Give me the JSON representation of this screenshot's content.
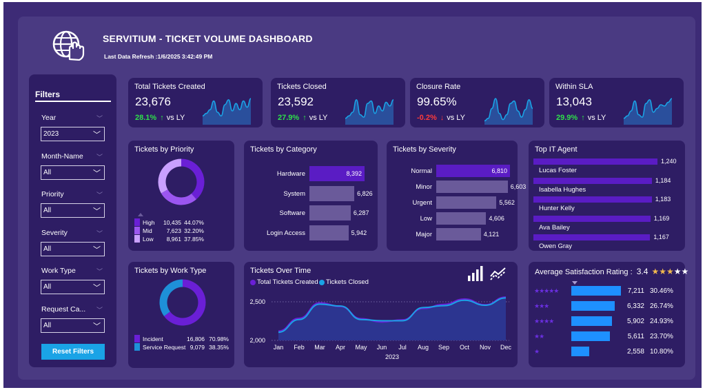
{
  "header": {
    "title": "SERVITIUM - TICKET VOLUME DASHBOARD",
    "refresh": "Last Data Refresh :1/6/2025 3:42:49 PM"
  },
  "filters": {
    "title": "Filters",
    "items": [
      {
        "label": "Year",
        "value": "2023"
      },
      {
        "label": "Month-Name",
        "value": "All"
      },
      {
        "label": "Priority",
        "value": "All"
      },
      {
        "label": "Severity",
        "value": "All"
      },
      {
        "label": "Work Type",
        "value": "All"
      },
      {
        "label": "Request Ca...",
        "value": "All"
      }
    ],
    "reset_label": "Reset Filters"
  },
  "kpis": [
    {
      "title": "Total Tickets Created",
      "value": "23,676",
      "change": "28.1%",
      "arrow": "↑",
      "direction": "up",
      "vs": "vs LY",
      "spark": [
        0.3,
        0.4,
        0.55,
        0.9,
        0.45,
        0.3,
        0.75,
        0.95,
        0.5,
        0.8,
        0.55,
        0.9,
        0.65,
        1.0
      ]
    },
    {
      "title": "Tickets Closed",
      "value": "23,592",
      "change": "27.9%",
      "arrow": "↑",
      "direction": "up",
      "vs": "vs LY",
      "spark": [
        0.2,
        0.3,
        0.45,
        0.95,
        0.35,
        0.25,
        0.8,
        0.9,
        0.4,
        0.7,
        0.5,
        0.85,
        0.7,
        0.95
      ]
    },
    {
      "title": "Closure Rate",
      "value": "99.65%",
      "change": "-0.2%",
      "arrow": "↓",
      "direction": "down",
      "vs": "vs LY",
      "spark": [
        0.1,
        0.2,
        0.6,
        1.0,
        0.4,
        0.15,
        0.35,
        0.8,
        0.9,
        0.5,
        0.25,
        0.55,
        0.95,
        0.6
      ]
    },
    {
      "title": "Within SLA",
      "value": "13,043",
      "change": "29.9%",
      "arrow": "↑",
      "direction": "up",
      "vs": "vs LY",
      "spark": [
        0.2,
        0.3,
        0.5,
        0.9,
        0.35,
        0.25,
        0.8,
        0.95,
        0.45,
        0.6,
        0.75,
        0.7,
        0.85,
        1.0
      ]
    }
  ],
  "priority": {
    "title": "Tickets by Priority",
    "items": [
      {
        "label": "High",
        "count": "10,435",
        "pct": "44.07%",
        "value": 10435,
        "color": "#6a1fd6"
      },
      {
        "label": "Mid",
        "count": "7,623",
        "pct": "32.20%",
        "value": 7623,
        "color": "#9b56f0"
      },
      {
        "label": "Low",
        "count": "8,961",
        "pct": "37.85%",
        "value": 8961,
        "color": "#c9a0ff"
      }
    ]
  },
  "worktype": {
    "title": "Tickets by Work Type",
    "items": [
      {
        "label": "Incident",
        "count": "16,806",
        "pct": "70.98%",
        "value": 16806,
        "color": "#6a1fd6"
      },
      {
        "label": "Service Request",
        "count": "9,079",
        "pct": "38.35%",
        "value": 9079,
        "color": "#1e90d8"
      }
    ]
  },
  "category": {
    "title": "Tickets by Category",
    "items": [
      {
        "label": "Hardware",
        "value": 8392,
        "display": "8,392"
      },
      {
        "label": "System",
        "value": 6826,
        "display": "6,826"
      },
      {
        "label": "Software",
        "value": 6287,
        "display": "6,287"
      },
      {
        "label": "Login Access",
        "value": 5942,
        "display": "5,942"
      }
    ]
  },
  "severity": {
    "title": "Tickets by Severity",
    "items": [
      {
        "label": "Normal",
        "value": 6810,
        "display": "6,810"
      },
      {
        "label": "Minor",
        "value": 6603,
        "display": "6,603"
      },
      {
        "label": "Urgent",
        "value": 5562,
        "display": "5,562"
      },
      {
        "label": "Low",
        "value": 4606,
        "display": "4,606"
      },
      {
        "label": "Major",
        "value": 4121,
        "display": "4,121"
      }
    ]
  },
  "agents": {
    "title": "Top IT Agent",
    "items": [
      {
        "label": "Lucas Foster",
        "value": 1240,
        "display": "1,240"
      },
      {
        "label": "Isabella Hughes",
        "value": 1184,
        "display": "1,184"
      },
      {
        "label": "Hunter Kelly",
        "value": 1183,
        "display": "1,183"
      },
      {
        "label": "Ava Bailey",
        "value": 1169,
        "display": "1,169"
      },
      {
        "label": "Owen Gray",
        "value": 1167,
        "display": "1,167"
      }
    ]
  },
  "satisfaction": {
    "title": "Average Satisfaction Rating :",
    "avg": "3.4",
    "stars_filled": 3,
    "items": [
      {
        "stars": 5,
        "count": "7,211",
        "pct": "30.46%",
        "value": 7211
      },
      {
        "stars": 3,
        "count": "6,332",
        "pct": "26.74%",
        "value": 6332
      },
      {
        "stars": 4,
        "count": "5,902",
        "pct": "24.93%",
        "value": 5902
      },
      {
        "stars": 2,
        "count": "5,611",
        "pct": "23.70%",
        "value": 5611
      },
      {
        "stars": 1,
        "count": "2,558",
        "pct": "10.80%",
        "value": 2558
      }
    ]
  },
  "colors": {
    "accent": "#5a1cc4",
    "positive": "#2ee04a",
    "negative": "#ff3b3b",
    "bar_grey": "#6a5a9a",
    "bar_blue": "#1e90ff",
    "star": "#f0b84e"
  },
  "chart_data": {
    "type": "area",
    "title": "Tickets Over Time",
    "xlabel": "2023",
    "x": [
      "Jan",
      "Feb",
      "Mar",
      "Apr",
      "May",
      "Jun",
      "Jul",
      "Aug",
      "Sep",
      "Oct",
      "Nov",
      "Dec"
    ],
    "yticks": [
      "2,500",
      "2,000"
    ],
    "ylim": [
      2000,
      2600
    ],
    "series": [
      {
        "name": "Total Tickets Created",
        "color": "#6a1fd6",
        "values": [
          2120,
          2285,
          2485,
          2440,
          2280,
          2240,
          2265,
          2415,
          2465,
          2535,
          2460,
          2560
        ]
      },
      {
        "name": "Tickets Closed",
        "color": "#1aa3e6",
        "values": [
          2105,
          2270,
          2470,
          2445,
          2270,
          2255,
          2255,
          2425,
          2450,
          2520,
          2455,
          2550
        ]
      }
    ]
  }
}
